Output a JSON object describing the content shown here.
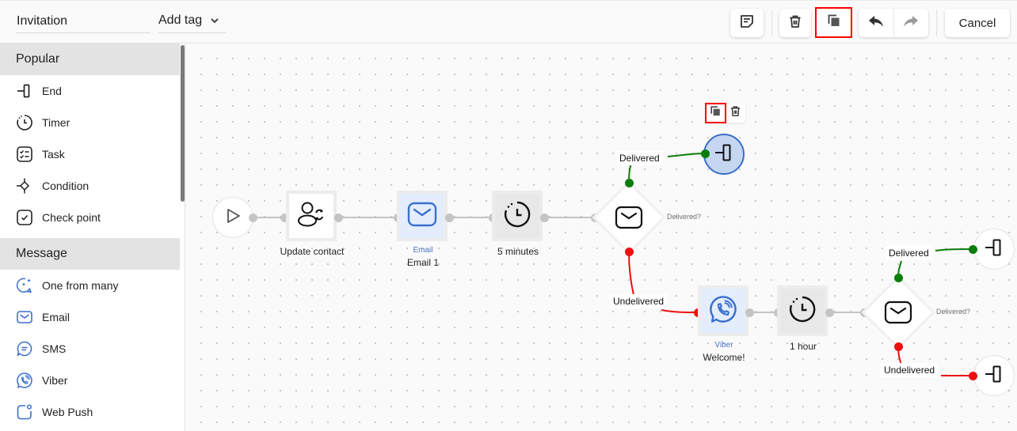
{
  "header": {
    "title_value": "Invitation",
    "tag_select_label": "Add tag",
    "cancel_label": "Cancel",
    "icons": {
      "note": "note-icon",
      "delete": "trash-icon",
      "copy": "copy-icon",
      "undo": "undo-icon",
      "redo": "redo-icon",
      "chevron": "chevron-down-icon"
    }
  },
  "sidebar": {
    "sections": [
      {
        "title": "Popular",
        "items": [
          {
            "label": "End",
            "icon": "end-icon"
          },
          {
            "label": "Timer",
            "icon": "timer-icon"
          },
          {
            "label": "Task",
            "icon": "task-icon"
          },
          {
            "label": "Condition",
            "icon": "condition-icon"
          },
          {
            "label": "Check point",
            "icon": "checkpoint-icon"
          }
        ]
      },
      {
        "title": "Message",
        "items": [
          {
            "label": "One from many",
            "icon": "one-from-many-icon"
          },
          {
            "label": "Email",
            "icon": "email-icon"
          },
          {
            "label": "SMS",
            "icon": "sms-icon"
          },
          {
            "label": "Viber",
            "icon": "viber-icon"
          },
          {
            "label": "Web Push",
            "icon": "web-push-icon"
          }
        ]
      }
    ]
  },
  "canvas": {
    "colors": {
      "delivered": "#0b7d0b",
      "undelivered": "#ee0f0f",
      "selected_border": "#3a6fc9",
      "message_accent": "#3b6fce",
      "highlight": "#ff0000"
    },
    "nodes": {
      "start": {
        "icon": "play-icon"
      },
      "update_contact": {
        "label": "Update contact",
        "icon": "user-sync-icon"
      },
      "email1": {
        "type_label": "Email",
        "label": "Email 1",
        "icon": "email-icon"
      },
      "timer1": {
        "label": "5 minutes",
        "icon": "timer-icon"
      },
      "cond1": {
        "question": "Delivered?",
        "delivered_label": "Delivered",
        "undelivered_label": "Undelivered",
        "icon": "email-icon"
      },
      "end_selected": {
        "icon": "end-icon"
      },
      "viber1": {
        "type_label": "Viber",
        "label": "Welcome!",
        "icon": "viber-icon"
      },
      "timer2": {
        "label": "1 hour",
        "icon": "timer-icon"
      },
      "cond2": {
        "question": "Delivered?",
        "delivered_label": "Delivered",
        "undelivered_label": "Undelivered",
        "icon": "email-icon"
      },
      "end2": {
        "icon": "end-icon"
      },
      "end3": {
        "icon": "end-icon"
      }
    },
    "node_toolbar": {
      "copy_icon": "copy-icon",
      "delete_icon": "trash-icon"
    }
  }
}
